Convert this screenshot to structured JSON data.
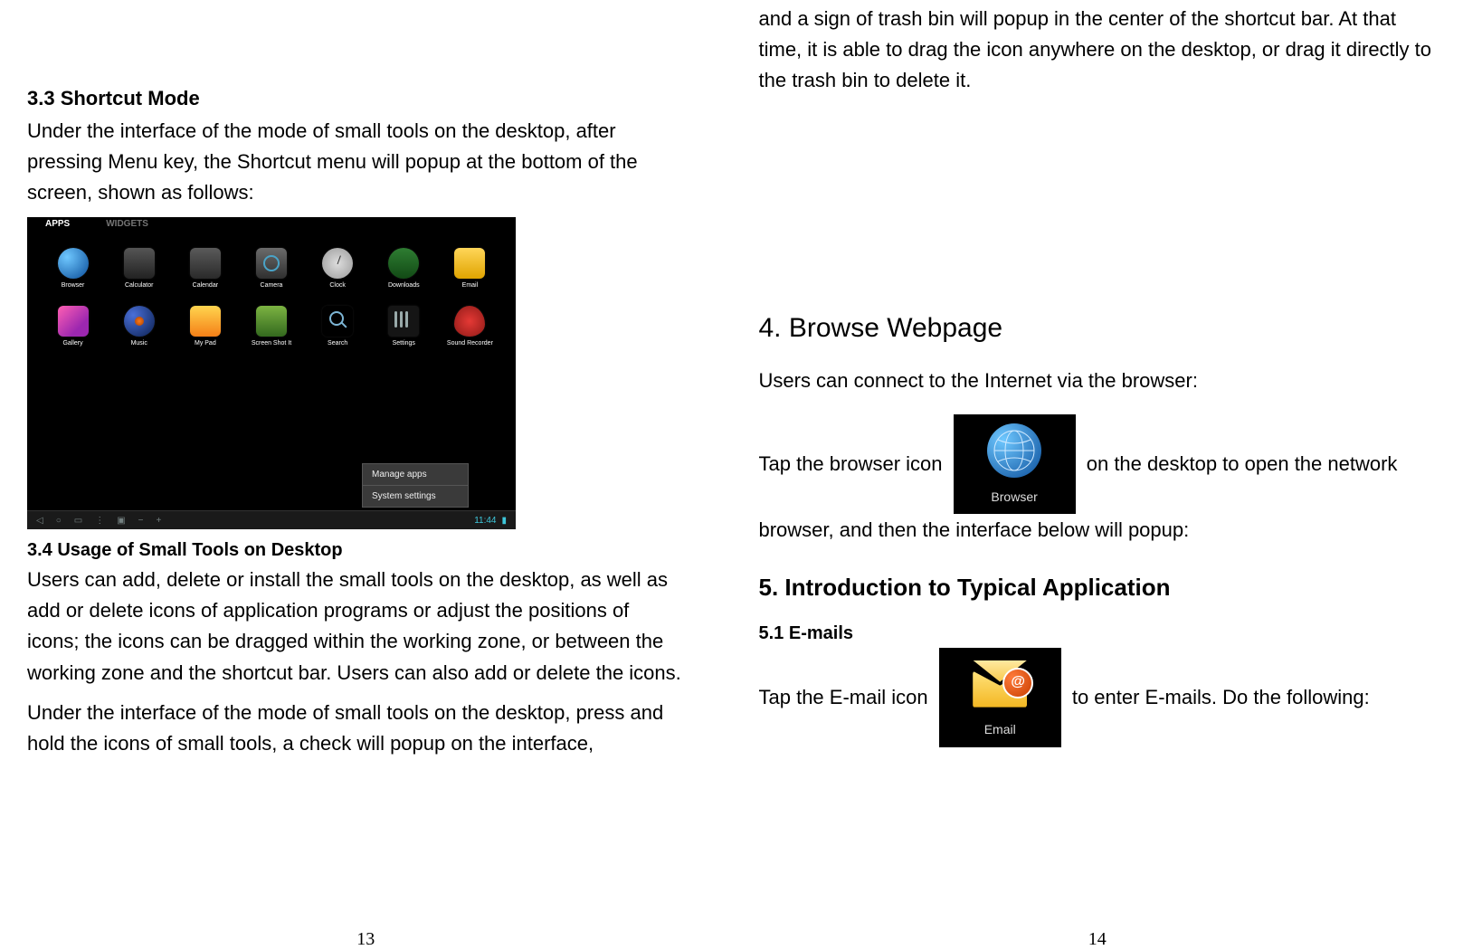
{
  "left": {
    "h_3_3": "3.3 Shortcut Mode",
    "p_3_3": "Under the interface of the mode of small tools on the desktop, after pressing Menu key, the Shortcut menu will popup at the bottom of the screen, shown as follows:",
    "h_3_4": "3.4 Usage of Small Tools on Desktop",
    "p_3_4a": "Users can add, delete or install the small tools on the desktop, as well as add or delete icons of application programs or adjust the positions of icons; the icons can be dragged within the working zone, or between the working zone and the shortcut bar. Users can also add or delete the icons.",
    "p_3_4b": "Under the interface of the mode of small tools on the desktop, press and hold the icons of small tools, a check will popup on the interface,",
    "page_num": "13"
  },
  "right": {
    "p_top": "and a sign of trash bin will popup in the center of the shortcut bar. At that time, it is able to drag the icon anywhere on the desktop, or drag it directly to the trash bin to delete it.",
    "h_4": "4. Browse Webpage",
    "p_4a": "Users can connect to the Internet via the browser:",
    "p_4b_pre": "Tap the browser icon ",
    "p_4b_post": " on the desktop to open the network browser, and then the interface below will popup:",
    "h_5": "5. Introduction to Typical Application",
    "h_5_1": "5.1 E-mails",
    "p_5_1_pre": "Tap the E-mail icon ",
    "p_5_1_post": " to enter E-mails. Do the following:",
    "page_num": "14"
  },
  "screenshot": {
    "tab_apps": "APPS",
    "tab_widgets": "WIDGETS",
    "apps": [
      {
        "label": "Browser",
        "cls": "i-browser"
      },
      {
        "label": "Calculator",
        "cls": "i-calc"
      },
      {
        "label": "Calendar",
        "cls": "i-cal"
      },
      {
        "label": "Camera",
        "cls": "i-camera"
      },
      {
        "label": "Clock",
        "cls": "i-clock"
      },
      {
        "label": "Downloads",
        "cls": "i-dl"
      },
      {
        "label": "Email",
        "cls": "i-email"
      },
      {
        "label": "Gallery",
        "cls": "i-gallery"
      },
      {
        "label": "Music",
        "cls": "i-music"
      },
      {
        "label": "My Pad",
        "cls": "i-mypad"
      },
      {
        "label": "Screen Shot It",
        "cls": "i-sshot"
      },
      {
        "label": "Search",
        "cls": "i-search"
      },
      {
        "label": "Settings",
        "cls": "i-settings"
      },
      {
        "label": "Sound Recorder",
        "cls": "i-record"
      }
    ],
    "menu": {
      "item1": "Manage apps",
      "item2": "System settings"
    },
    "clock": "11:44"
  },
  "inline_icons": {
    "browser_label": "Browser",
    "email_label": "Email",
    "at_glyph": "@"
  }
}
